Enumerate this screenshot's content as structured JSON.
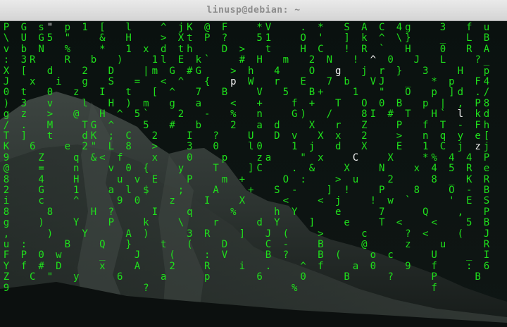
{
  "window": {
    "title": "linusp@debian: ~"
  },
  "colors": {
    "rain": "#1fe01c",
    "head": "#f2f2f2",
    "background": "#050807",
    "titlebar": "#dedede",
    "title_text": "#8c8c8c"
  },
  "terminal": {
    "columns": [
      "PGs\"p1[ l ^jK@F *V .* SAC4g 3 fu",
      "\\UG5\" & H >XtP? 51 O' ]k^\\} _ LB",
      "vbN % * 1xdth D> t HC !R` H 0 RA",
      ":3R R b ) 1lEk` #H m 2N !^0 J L ?_",
      "X[ d 2 D |mG#G >h 4 O g jr} 3 H p",
      "J x i g S = <^ { pW r E 7b VJ _ *p F4",
      "0t 0 z I t [^ 7 B V 5 B+ 1 \" O p]d./",
      ")3 v l H)m g a < + f+ T O0B p|,P8",
      "gz > @ H^5` 2 - % n G) / 8I#T H`lkd",
      "/. M TG^ 5 # b 2 ad X r Z P fT-Fh",
      "T] t dK;C 2 I ? U Dv Xx 2 > nqye[",
      "K 6 e2\"L8 > 3 0 l0 1j d X E 1Cjzj",
      "9 Z q&<f x 0 p za \"x C X *%44P",
      "@ = n v0{ y T ]C .& X N x45Re",
      "8 4 H uvE P m+ O: >u 2 8_KR",
      "2 G 1 al$ ; A + S- ]! P 8 O-B",
      "i c ^ 90 z I X < <j !w` 'ES",
      "8 8 H? I q % hY e 7 Q ,P",
      "g ) Y P k \\ r dY ] e T< < 5B",
      ", ) Y A) 3R ]J( > c ?< (J",
      "u: B Q} t( D C- B @ z u R",
      "FP0w _ J ( :V B? B( oc U _I",
      "Yf#D x A 2 R i. ^f a0 9f :6",
      "ZC\"y 6 a p 6 0 B ? P B",
      "9 ? % f"
    ]
  }
}
